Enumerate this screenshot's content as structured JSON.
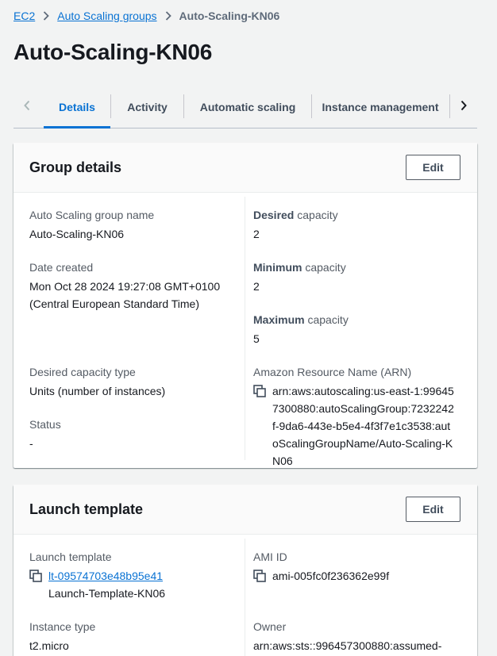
{
  "breadcrumb": {
    "items": [
      {
        "label": "EC2"
      },
      {
        "label": "Auto Scaling groups"
      }
    ],
    "current": "Auto-Scaling-KN06"
  },
  "page_title": "Auto-Scaling-KN06",
  "tabs": [
    {
      "label": "Details",
      "active": true
    },
    {
      "label": "Activity"
    },
    {
      "label": "Automatic scaling"
    },
    {
      "label": "Instance management"
    }
  ],
  "group_details": {
    "title": "Group details",
    "edit_label": "Edit",
    "asg_name_label": "Auto Scaling group name",
    "asg_name_value": "Auto-Scaling-KN06",
    "date_created_label": "Date created",
    "date_created_value_line1": "Mon Oct 28 2024 19:27:08 GMT+0100",
    "date_created_value_line2": "(Central European Standard Time)",
    "desired_capacity_type_label": "Desired capacity type",
    "desired_capacity_type_value": "Units (number of instances)",
    "status_label": "Status",
    "status_value": "-",
    "desired_label_bold": "Desired",
    "desired_label_rest": " capacity",
    "desired_value": "2",
    "minimum_label_bold": "Minimum",
    "minimum_label_rest": " capacity",
    "minimum_value": "2",
    "maximum_label_bold": "Maximum",
    "maximum_label_rest": " capacity",
    "maximum_value": "5",
    "arn_label": "Amazon Resource Name (ARN)",
    "arn_value": "arn:aws:autoscaling:us-east-1:996457300880:autoScalingGroup:7232242f-9da6-443e-b5e4-4f3f7e1c3538:autoScalingGroupName/Auto-Scaling-KN06"
  },
  "launch_template": {
    "title": "Launch template",
    "edit_label": "Edit",
    "lt_label": "Launch template",
    "lt_id": "lt-09574703e48b95e41",
    "lt_name": "Launch-Template-KN06",
    "instance_type_label": "Instance type",
    "instance_type_value": "t2.micro",
    "ami_label": "AMI ID",
    "ami_value": "ami-005fc0f236362e99f",
    "owner_label": "Owner",
    "owner_value": "arn:aws:sts::996457300880:assumed-"
  },
  "icons": {
    "chevron_left": "chevron-left-icon",
    "chevron_right": "chevron-right-icon",
    "copy": "copy-icon"
  },
  "colors": {
    "link": "#0972d3",
    "page_bg": "#f2f3f3",
    "text": "#16191f",
    "muted": "#545b64"
  }
}
